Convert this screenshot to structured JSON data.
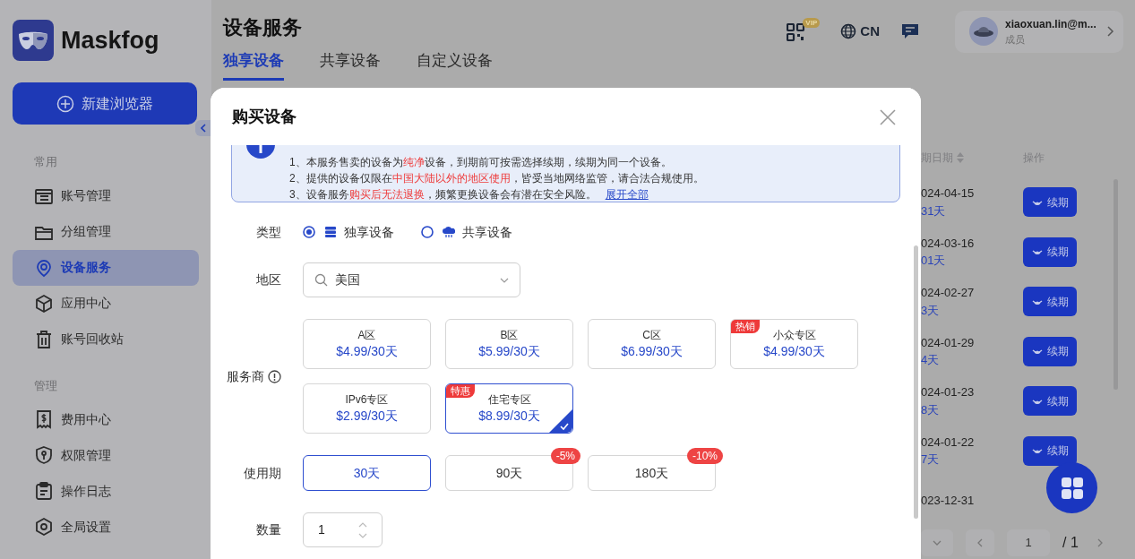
{
  "sidebar": {
    "logo": "Maskfog",
    "new_button": "新建浏览器",
    "sections": [
      {
        "title": "常用",
        "items": [
          {
            "label": "账号管理",
            "selected": false
          },
          {
            "label": "分组管理",
            "selected": false
          },
          {
            "label": "设备服务",
            "selected": true
          },
          {
            "label": "应用中心",
            "selected": false
          },
          {
            "label": "账号回收站",
            "selected": false
          }
        ]
      },
      {
        "title": "管理",
        "items": [
          {
            "label": "费用中心",
            "selected": false
          },
          {
            "label": "权限管理",
            "selected": false
          },
          {
            "label": "操作日志",
            "selected": false
          },
          {
            "label": "全局设置",
            "selected": false
          }
        ]
      }
    ]
  },
  "header": {
    "title": "设备服务",
    "tabs": [
      {
        "label": "独享设备",
        "selected": true
      },
      {
        "label": "共享设备",
        "selected": false
      },
      {
        "label": "自定义设备",
        "selected": false
      }
    ],
    "vip_badge": "VIP",
    "language": "CN",
    "user": {
      "name": "xiaoxuan.lin@m...",
      "role": "成员"
    }
  },
  "table": {
    "columns": [
      "期日期",
      "操作"
    ],
    "rows": [
      {
        "date": "024-04-15",
        "days": "31天",
        "action": "续期"
      },
      {
        "date": "024-03-16",
        "days": "01天",
        "action": "续期"
      },
      {
        "date": "024-02-27",
        "days": "3天",
        "action": "续期"
      },
      {
        "date": "024-01-29",
        "days": "4天",
        "action": "续期"
      },
      {
        "date": "024-01-23",
        "days": "8天",
        "action": "续期"
      },
      {
        "date": "024-01-22",
        "days": "7天",
        "action": "续期"
      },
      {
        "date": "023-12-31"
      }
    ]
  },
  "pagination": {
    "page": "1",
    "total": "/ 1"
  },
  "modal": {
    "title": "购买设备",
    "notice": [
      [
        {
          "text": "1、本服务售卖的设备为",
          "warn": false
        },
        {
          "text": "纯净",
          "warn": true
        },
        {
          "text": "设备，到期前可按需选择续期，续期为同一个设备。",
          "warn": false
        }
      ],
      [
        {
          "text": "2、提供的设备仅限在",
          "warn": false
        },
        {
          "text": "中国大陆以外的地区使用",
          "warn": true
        },
        {
          "text": "，皆受当地网络监管，请合法合规使用。",
          "warn": false
        }
      ],
      [
        {
          "text": "3、设备服务",
          "warn": false
        },
        {
          "text": "购买后无法退换",
          "warn": true
        },
        {
          "text": "，频繁更换设备会有潜在安全风险。",
          "warn": false
        }
      ]
    ],
    "expand_link": "展开全部",
    "type_label": "类型",
    "types": [
      {
        "label": "独享设备",
        "kind": "dedicated",
        "selected": true
      },
      {
        "label": "共享设备",
        "kind": "shared",
        "selected": false
      }
    ],
    "region_label": "地区",
    "region": "美国",
    "provider_label": "服务商",
    "providers": [
      {
        "name": "A区",
        "price": "$4.99/30天",
        "selected": false
      },
      {
        "name": "B区",
        "price": "$5.99/30天",
        "selected": false
      },
      {
        "name": "C区",
        "price": "$6.99/30天",
        "selected": false
      },
      {
        "name": "小众专区",
        "price": "$4.99/30天",
        "tag": "热销",
        "selected": false
      },
      {
        "name": "IPv6专区",
        "price": "$2.99/30天",
        "selected": false
      },
      {
        "name": "住宅专区",
        "price": "$8.99/30天",
        "tag": "特惠",
        "selected": true
      }
    ],
    "period_label": "使用期",
    "periods": [
      {
        "label": "30天",
        "selected": true
      },
      {
        "label": "90天",
        "discount": "-5%",
        "selected": false
      },
      {
        "label": "180天",
        "discount": "-10%",
        "selected": false
      }
    ],
    "quantity_label": "数量",
    "quantity": "1"
  }
}
